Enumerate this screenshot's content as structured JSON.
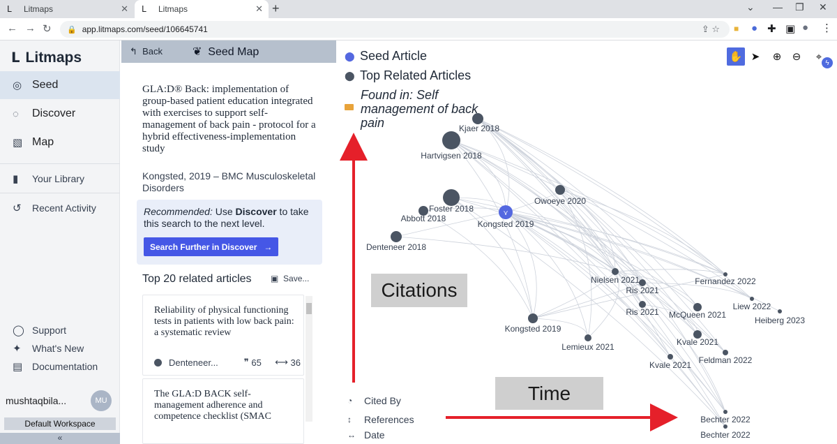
{
  "browser": {
    "tabs": [
      {
        "title": "Litmaps"
      },
      {
        "title": "Litmaps"
      }
    ],
    "url": "app.litmaps.com/seed/106645741"
  },
  "sidebar": {
    "brand": "Litmaps",
    "nav": [
      {
        "label": "Seed",
        "icon": "seed-icon"
      },
      {
        "label": "Discover",
        "icon": "discover-icon"
      },
      {
        "label": "Map",
        "icon": "map-icon"
      }
    ],
    "secondary": [
      {
        "label": "Your Library",
        "icon": "library-icon"
      },
      {
        "label": "Recent Activity",
        "icon": "history-icon"
      }
    ],
    "footer": [
      {
        "label": "Support",
        "icon": "support-icon"
      },
      {
        "label": "What's New",
        "icon": "sparkle-icon"
      },
      {
        "label": "Documentation",
        "icon": "book-icon"
      }
    ],
    "user": {
      "name": "mushtaqbila...",
      "initials": "MU"
    },
    "workspace": "Default Workspace",
    "collapse": "«"
  },
  "panel": {
    "back": "Back",
    "title": "Seed Map",
    "article": {
      "title": "GLA:D® Back: implementation of group-based patient education integrated with exercises to support self-management of back pain - protocol for a hybrid effectiveness-implementation study",
      "meta": "Kongsted, 2019 – BMC Musculoskeletal Disorders"
    },
    "recommend": {
      "prefix": "Recommended:",
      "mid": " Use ",
      "bold": "Discover",
      "suffix": " to take this search to the next level.",
      "button": "Search Further in Discover"
    },
    "related_header": "Top 20 related articles",
    "save": "Save...",
    "cards": [
      {
        "title": "Reliability of physical functioning tests in patients with low back pain: a systematic review",
        "author": "Denteneer...",
        "citations": "65",
        "refs": "36"
      },
      {
        "title": "The GLA:D BACK self-management adherence and competence checklist (SMAC",
        "author": "",
        "citations": "",
        "refs": ""
      }
    ]
  },
  "map": {
    "legend": {
      "seed": "Seed Article",
      "top": "Top Related Articles",
      "found": "Found in: Self management of back pain"
    },
    "bottom_legend": [
      {
        "label": "Cited By",
        "icon": "cited-by-icon"
      },
      {
        "label": "References",
        "icon": "references-icon"
      },
      {
        "label": "Date",
        "icon": "date-icon"
      }
    ],
    "overlays": {
      "citations": "Citations",
      "time": "Time"
    },
    "nodes": [
      {
        "label": "Kjaer 2018"
      },
      {
        "label": "Hartvigsen 2018"
      },
      {
        "label": "Owoeye 2020"
      },
      {
        "label": "Foster 2018"
      },
      {
        "label": "Abbott 2018"
      },
      {
        "label": "Kongsted 2019",
        "seed": true
      },
      {
        "label": "Denteneer 2018"
      },
      {
        "label": "Nielsen 2021"
      },
      {
        "label": "Ris 2021"
      },
      {
        "label": "Fernandez 2022"
      },
      {
        "label": "Ris 2021"
      },
      {
        "label": "Liew 2022"
      },
      {
        "label": "McQueen 2021"
      },
      {
        "label": "Heiberg 2023"
      },
      {
        "label": "Kongsted 2019"
      },
      {
        "label": "Kvale 2021"
      },
      {
        "label": "Lemieux 2021"
      },
      {
        "label": "Feldman 2022"
      },
      {
        "label": "Kvale 2021"
      },
      {
        "label": "Bechter 2022"
      },
      {
        "label": "Bechter 2022"
      }
    ]
  },
  "colors": {
    "accent": "#4557e6",
    "node": "#4b5563",
    "seed": "#5468e0",
    "arrow": "#e5202a"
  }
}
